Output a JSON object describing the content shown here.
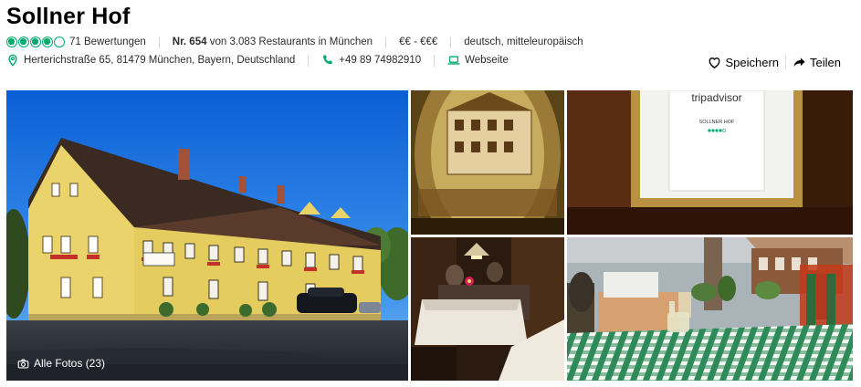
{
  "restaurant": {
    "name": "Sollner Hof",
    "rating_bubbles": 4,
    "rating_max": 5,
    "reviews": "71 Bewertungen",
    "rank_prefix": "Nr. 654",
    "rank_suffix": "von 3.083 Restaurants in München",
    "price": "€€ - €€€",
    "cuisine": "deutsch, mitteleuropäisch"
  },
  "contact": {
    "address": "Herterichstraße 65, 81479 München, Bayern, Deutschland",
    "phone": "+49 89 74982910",
    "website": "Webseite"
  },
  "actions": {
    "save": "Speichern",
    "share": "Teilen"
  },
  "gallery": {
    "all_photos": "Alle Fotos (23)",
    "sign_brand": "tripadvisor",
    "sign_name": "SOLLNER HOF"
  },
  "colors": {
    "brand_green": "#00aa6c",
    "phone_green": "#00aa6c"
  },
  "icons": [
    "map-pin-icon",
    "phone-icon",
    "laptop-icon",
    "heart-icon",
    "share-arrow-icon",
    "camera-icon"
  ]
}
